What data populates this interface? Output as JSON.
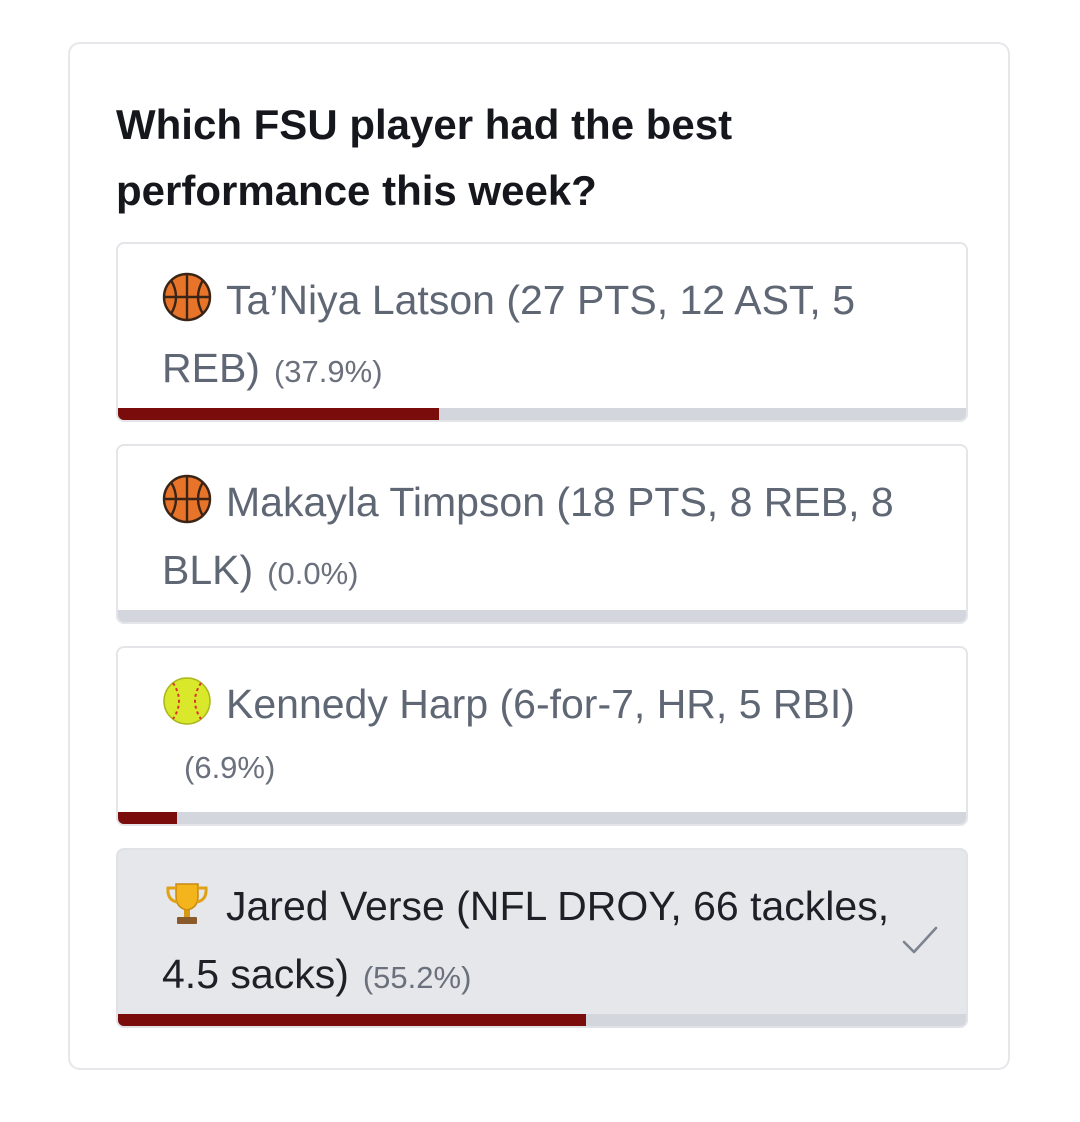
{
  "poll": {
    "question": "Which FSU player had the best performance this week?",
    "options": [
      {
        "icon": "basketball-icon",
        "label": "Ta’Niya Latson (27 PTS, 12 AST, 5 REB)",
        "percent_text": "(37.9%)",
        "percent": 37.9,
        "selected": false
      },
      {
        "icon": "basketball-icon",
        "label": "Makayla Timpson (18 PTS, 8 REB, 8 BLK)",
        "percent_text": "(0.0%)",
        "percent": 0.0,
        "selected": false
      },
      {
        "icon": "softball-icon",
        "label": "Kennedy Harp (6-for-7, HR, 5 RBI)",
        "percent_text": "(6.9%)",
        "percent": 6.9,
        "selected": false
      },
      {
        "icon": "trophy-icon",
        "label": "Jared Verse (NFL DROY, 66 tackles, 4.5 sacks)",
        "percent_text": "(55.2%)",
        "percent": 55.2,
        "selected": true
      }
    ]
  },
  "colors": {
    "bar_fill": "#7a0c0c",
    "bar_track": "#d3d6dc",
    "selected_bg": "#e6e7ea"
  }
}
